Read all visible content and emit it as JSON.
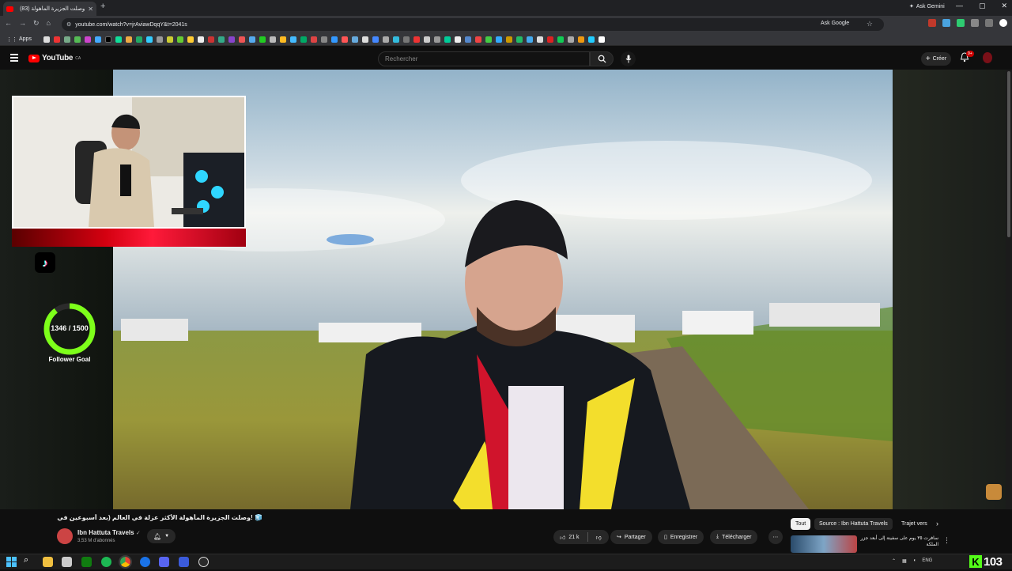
{
  "browser": {
    "tab_title": "وصلت الجزيرة المأهولة (83)",
    "new_tab_symbol": "+",
    "gemini_label": "Ask Gemini",
    "url": "youtube.com/watch?v=jrAviawDqqY&t=2041s",
    "ask_google_label": "Ask Google",
    "apps_label": "Apps",
    "window_controls": [
      "—",
      "▢",
      "✕"
    ]
  },
  "youtube": {
    "logo_text": "YouTube",
    "country_code": "CA",
    "search_placeholder": "Rechercher",
    "create_label": "Créer",
    "notification_count": "9+"
  },
  "overlay": {
    "follower_goal_current": 1346,
    "follower_goal_target": 1500,
    "follower_goal_text": "1346 / 1500",
    "follower_goal_label": "Follower Goal",
    "ring_color": "#7dff1a"
  },
  "video": {
    "title": "⁦🧊⁩ !وصلت الجزيرة المأهولة الأكثر عزلة في العالم (بعد أسبوعين في المحيط)",
    "channel_name": "Ibn Hattuta Travels",
    "subscribers": "3,53 M d'abonnés",
    "likes": "21 k",
    "share_label": "Partager",
    "save_label": "Enregistrer",
    "download_label": "Télécharger"
  },
  "recommendations": {
    "chips": [
      "Tout",
      "Source : Ibn Hattuta Travels",
      "Trajet vers"
    ],
    "first_title": "سافرت ٣٥ يوم على سفينة إلى أبعد جزر الملكة"
  },
  "taskbar": {
    "language": "ENG",
    "kick_count": "103"
  },
  "colors": {
    "youtube_red": "#ff0000",
    "kick_green": "#53fc18",
    "background": "#0f0f0f"
  }
}
